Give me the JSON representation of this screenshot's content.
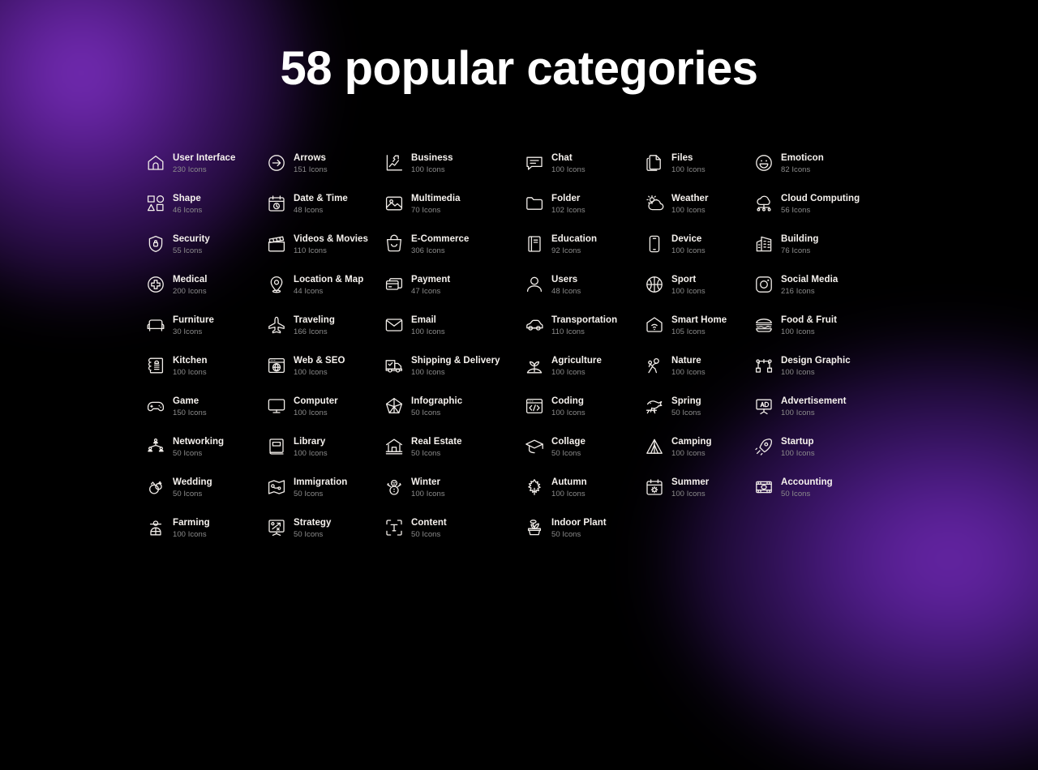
{
  "page": {
    "title": "58 popular categories",
    "background_color": "#000000",
    "accent_glow_color": "#7b2fbe",
    "title_color": "#ffffff",
    "category_name_color": "#f6f2ee",
    "category_count_color": "#8c8c8c",
    "icon_color": "#f2eeea",
    "count_suffix": "Icons"
  },
  "columns": [
    {
      "index": 1,
      "items": [
        {
          "name": "User Interface",
          "count": "230 Icons",
          "icon": "home-icon"
        },
        {
          "name": "Shape",
          "count": "46 Icons",
          "icon": "shapes-icon"
        },
        {
          "name": "Security",
          "count": "55 Icons",
          "icon": "shield-lock-icon"
        },
        {
          "name": "Medical",
          "count": "200 Icons",
          "icon": "medical-cross-circle-icon"
        },
        {
          "name": "Furniture",
          "count": "30 Icons",
          "icon": "armchair-icon"
        },
        {
          "name": "Kitchen",
          "count": "100 Icons",
          "icon": "recipe-book-icon"
        },
        {
          "name": "Game",
          "count": "150 Icons",
          "icon": "gamepad-icon"
        },
        {
          "name": "Networking",
          "count": "50 Icons",
          "icon": "network-nodes-icon"
        },
        {
          "name": "Wedding",
          "count": "50 Icons",
          "icon": "wedding-rings-icon"
        },
        {
          "name": "Farming",
          "count": "100 Icons",
          "icon": "farmer-icon"
        }
      ]
    },
    {
      "index": 2,
      "items": [
        {
          "name": "Arrows",
          "count": "151 Icons",
          "icon": "arrow-right-circle-icon"
        },
        {
          "name": "Date & Time",
          "count": "48 Icons",
          "icon": "calendar-clock-icon"
        },
        {
          "name": "Videos & Movies",
          "count": "110 Icons",
          "icon": "clapperboard-icon"
        },
        {
          "name": "Location & Map",
          "count": "44 Icons",
          "icon": "map-pin-icon"
        },
        {
          "name": "Traveling",
          "count": "166 Icons",
          "icon": "airplane-icon"
        },
        {
          "name": "Web & SEO",
          "count": "100 Icons",
          "icon": "browser-globe-icon"
        },
        {
          "name": "Computer",
          "count": "100 Icons",
          "icon": "monitor-icon"
        },
        {
          "name": "Library",
          "count": "100 Icons",
          "icon": "book-icon"
        },
        {
          "name": "Immigration",
          "count": "50 Icons",
          "icon": "map-route-icon"
        },
        {
          "name": "Strategy",
          "count": "50 Icons",
          "icon": "strategy-board-icon"
        }
      ]
    },
    {
      "index": 3,
      "items": [
        {
          "name": "Business",
          "count": "100 Icons",
          "icon": "growth-chart-icon"
        },
        {
          "name": "Multimedia",
          "count": "70 Icons",
          "icon": "image-icon"
        },
        {
          "name": "E-Commerce",
          "count": "306 Icons",
          "icon": "shopping-bag-icon"
        },
        {
          "name": "Payment",
          "count": "47 Icons",
          "icon": "credit-cards-icon"
        },
        {
          "name": "Email",
          "count": "100 Icons",
          "icon": "envelope-icon"
        },
        {
          "name": "Shipping & Delivery",
          "count": "100 Icons",
          "icon": "delivery-truck-icon"
        },
        {
          "name": "Infographic",
          "count": "50 Icons",
          "icon": "pentagon-chart-icon"
        },
        {
          "name": "Real Estate",
          "count": "50 Icons",
          "icon": "house-pillars-icon"
        },
        {
          "name": "Winter",
          "count": "100 Icons",
          "icon": "snowman-icon"
        },
        {
          "name": "Content",
          "count": "50 Icons",
          "icon": "text-frame-icon"
        }
      ]
    },
    {
      "index": 4,
      "items": [
        {
          "name": "Chat",
          "count": "100 Icons",
          "icon": "chat-bubble-icon"
        },
        {
          "name": "Folder",
          "count": "102 Icons",
          "icon": "folder-icon"
        },
        {
          "name": "Education",
          "count": "92 Icons",
          "icon": "textbook-icon"
        },
        {
          "name": "Users",
          "count": "48 Icons",
          "icon": "user-icon"
        },
        {
          "name": "Transportation",
          "count": "110 Icons",
          "icon": "car-icon"
        },
        {
          "name": "Agriculture",
          "count": "100 Icons",
          "icon": "sprout-icon"
        },
        {
          "name": "Coding",
          "count": "100 Icons",
          "icon": "code-window-icon"
        },
        {
          "name": "Collage",
          "count": "50 Icons",
          "icon": "graduation-cap-icon"
        },
        {
          "name": "Autumn",
          "count": "100 Icons",
          "icon": "maple-leaf-icon"
        },
        {
          "name": "Indoor Plant",
          "count": "50 Icons",
          "icon": "potted-plant-icon"
        }
      ]
    },
    {
      "index": 5,
      "items": [
        {
          "name": "Files",
          "count": "100 Icons",
          "icon": "files-icon"
        },
        {
          "name": "Weather",
          "count": "100 Icons",
          "icon": "sun-cloud-icon"
        },
        {
          "name": "Device",
          "count": "100 Icons",
          "icon": "smartphone-icon"
        },
        {
          "name": "Sport",
          "count": "100 Icons",
          "icon": "basketball-icon"
        },
        {
          "name": "Smart Home",
          "count": "105 Icons",
          "icon": "smart-home-wifi-icon"
        },
        {
          "name": "Nature",
          "count": "100 Icons",
          "icon": "nature-people-icon"
        },
        {
          "name": "Spring",
          "count": "50 Icons",
          "icon": "bird-branch-icon"
        },
        {
          "name": "Camping",
          "count": "100 Icons",
          "icon": "tent-icon"
        },
        {
          "name": "Summer",
          "count": "100 Icons",
          "icon": "summer-calendar-icon"
        }
      ]
    },
    {
      "index": 6,
      "items": [
        {
          "name": "Emoticon",
          "count": "82 Icons",
          "icon": "smiley-face-icon"
        },
        {
          "name": "Cloud Computing",
          "count": "56 Icons",
          "icon": "cloud-network-icon"
        },
        {
          "name": "Building",
          "count": "76 Icons",
          "icon": "building-icon"
        },
        {
          "name": "Social Media",
          "count": "216 Icons",
          "icon": "camera-square-icon"
        },
        {
          "name": "Food & Fruit",
          "count": "100 Icons",
          "icon": "burger-icon"
        },
        {
          "name": "Design Graphic",
          "count": "100 Icons",
          "icon": "node-graph-icon"
        },
        {
          "name": "Advertisement",
          "count": "100 Icons",
          "icon": "ad-billboard-icon"
        },
        {
          "name": "Startup",
          "count": "100 Icons",
          "icon": "rocket-icon"
        },
        {
          "name": "Accounting",
          "count": "50 Icons",
          "icon": "cash-box-icon"
        }
      ]
    }
  ]
}
